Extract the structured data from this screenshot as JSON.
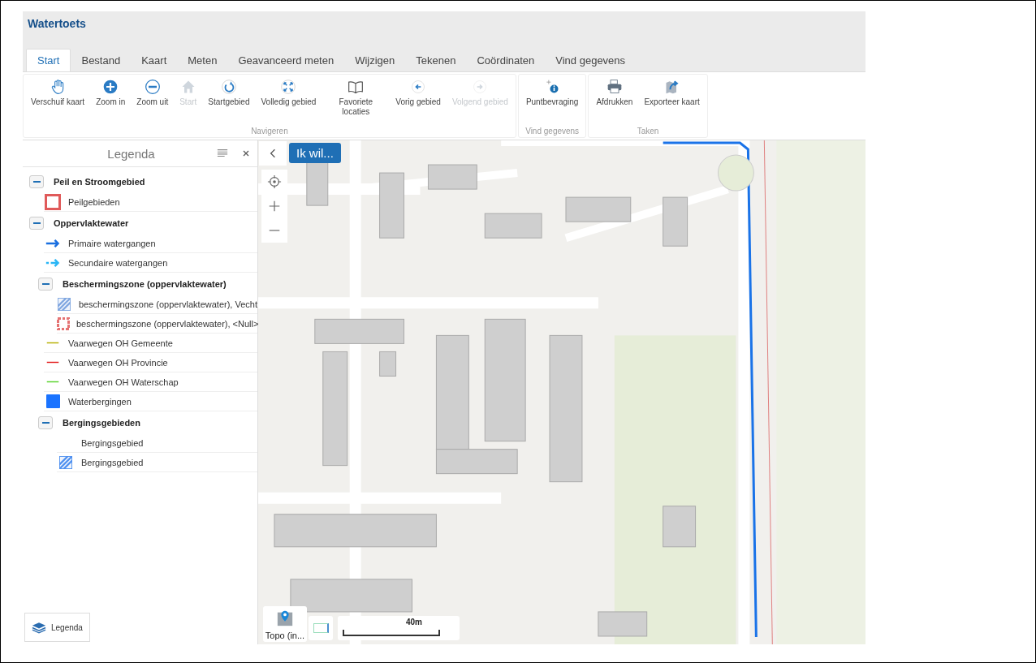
{
  "app": {
    "title": "Watertoets"
  },
  "tabs": [
    {
      "label": "Start",
      "selected": true
    },
    {
      "label": "Bestand",
      "selected": false
    },
    {
      "label": "Kaart",
      "selected": false
    },
    {
      "label": "Meten",
      "selected": false
    },
    {
      "label": "Geavanceerd meten",
      "selected": false
    },
    {
      "label": "Wijzigen",
      "selected": false
    },
    {
      "label": "Tekenen",
      "selected": false
    },
    {
      "label": "Coördinaten",
      "selected": false
    },
    {
      "label": "Vind gegevens",
      "selected": false
    }
  ],
  "ribbon_groups": [
    {
      "label": "Navigeren",
      "buttons": [
        {
          "label": "Verschuif kaart",
          "disabled": false
        },
        {
          "label": "Zoom in",
          "disabled": false
        },
        {
          "label": "Zoom uit",
          "disabled": false
        },
        {
          "label": "Start",
          "disabled": true
        },
        {
          "label": "Startgebied",
          "disabled": false
        },
        {
          "label": "Volledig gebied",
          "disabled": false
        },
        {
          "label": "Favoriete locaties",
          "disabled": false
        },
        {
          "label": "Vorig gebied",
          "disabled": false
        },
        {
          "label": "Volgend gebied",
          "disabled": true
        }
      ]
    },
    {
      "label": "Vind gegevens",
      "buttons": [
        {
          "label": "Puntbevraging",
          "disabled": false
        }
      ]
    },
    {
      "label": "Taken",
      "buttons": [
        {
          "label": "Afdrukken",
          "disabled": false
        },
        {
          "label": "Exporteer kaart",
          "disabled": false
        }
      ]
    }
  ],
  "legend": {
    "title": "Legenda",
    "items": [
      {
        "kind": "group",
        "label": "Peil en Stroomgebied",
        "expanded": true,
        "children": [
          {
            "kind": "outline-box",
            "label": "Peilgebieden",
            "color": "#e05a5a"
          }
        ]
      },
      {
        "kind": "group",
        "label": "Oppervlaktewater",
        "expanded": true,
        "children": [
          {
            "kind": "arrow",
            "label": "Primaire watergangen",
            "color": "#1a6fe0"
          },
          {
            "kind": "dashed-arrow",
            "label": "Secundaire watergangen",
            "color": "#29b6f6"
          },
          {
            "kind": "group",
            "label": "Beschermingszone (oppervlaktewater)",
            "expanded": true,
            "children": [
              {
                "kind": "hatch",
                "label": "beschermingszone (oppervlaktewater), Vecht",
                "color": "#7fa6e0"
              },
              {
                "kind": "dashed-box",
                "label": "beschermingszone (oppervlaktewater), <Null>",
                "color": "#e57373"
              }
            ]
          },
          {
            "kind": "line",
            "label": "Vaarwegen OH Gemeente",
            "color": "#b5b000"
          },
          {
            "kind": "line",
            "label": "Vaarwegen OH Provincie",
            "color": "#e21b1b"
          },
          {
            "kind": "line",
            "label": "Vaarwegen OH Waterschap",
            "color": "#58d22a"
          },
          {
            "kind": "fill",
            "label": "Waterbergingen",
            "color": "#1a73ff"
          },
          {
            "kind": "group",
            "label": "Bergingsgebieden",
            "expanded": true,
            "children": [
              {
                "kind": "none",
                "label": "Bergingsgebied"
              },
              {
                "kind": "hatch",
                "label": "Bergingsgebied",
                "color": "#4d8ff0"
              }
            ]
          }
        ]
      }
    ]
  },
  "legend_tab": {
    "label": "Legenda"
  },
  "map": {
    "action_button": "Ik wil...",
    "basemap": "Topo (in...",
    "scale": "40m"
  }
}
